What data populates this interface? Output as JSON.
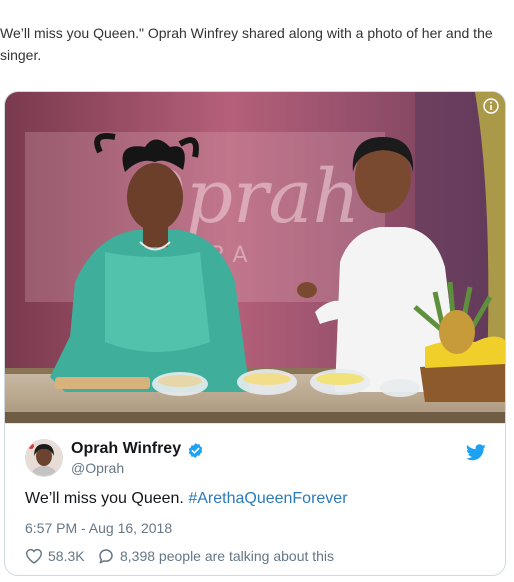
{
  "article": {
    "line1": "We’ll miss you Queen.\" Oprah Winfrey shared along with a photo of her and the",
    "line2": "singer."
  },
  "tweet": {
    "author_name": "Oprah Winfrey",
    "author_handle": "@Oprah",
    "text_plain": "We’ll miss you Queen. ",
    "text_hashtag": "#ArethaQueenForever",
    "timestamp": "6:57 PM - Aug 16, 2018",
    "likes": "58.3K",
    "talking": "8,398 people are talking about this"
  },
  "photo": {
    "backdrop_logo": "Oprah",
    "backdrop_sub": "P R A"
  },
  "icons": {
    "info": "info-icon",
    "verified": "verified-badge-icon",
    "bird": "twitter-bird-icon",
    "heart": "heart-icon",
    "reply": "reply-bubble-icon"
  },
  "colors": {
    "hashtag": "#2b7bb9",
    "twitter_blue": "#1da1f2",
    "meta_gray": "#657786",
    "name_black": "#14171a"
  }
}
